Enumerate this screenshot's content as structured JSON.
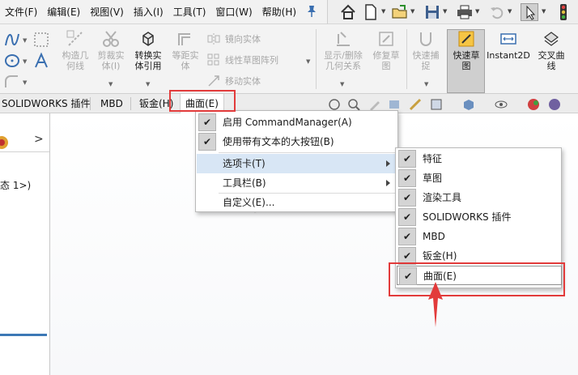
{
  "menubar": {
    "items": [
      "文件(F)",
      "编辑(E)",
      "视图(V)",
      "插入(I)",
      "工具(T)",
      "窗口(W)",
      "帮助(H)"
    ]
  },
  "quickbar": {
    "icons": [
      "home-icon",
      "new-document-icon",
      "open-folder-icon",
      "save-icon",
      "print-icon",
      "undo-icon",
      "select-pointer-icon",
      "traffic-light-icon"
    ]
  },
  "ribbon": {
    "buttons": {
      "construct_geometry": "构造几\n何线",
      "cut_entities": "剪裁实\n体(I)",
      "convert_entities": "转换实\n体引用",
      "offset_entities": "等距实\n体",
      "mirror_entities": "镜向实体",
      "linear_pattern": "线性草图阵列",
      "move_entities": "移动实体",
      "show_delete_relations": "显示/删除\n几何关系",
      "repair_sketch": "修复草\n图",
      "quick_snaps": "快速捕\n捉",
      "rapid_sketch": "快速草\n图",
      "instant2d": "Instant2D",
      "intersection_curve": "交叉曲\n线"
    }
  },
  "tabs": {
    "plugins": "SOLIDWORKS 插件",
    "mbd": "MBD",
    "sheet_metal": "钣金(H)",
    "surfaces": "曲面(E)"
  },
  "left_panel": {
    "tree_text": "态 1>)",
    "arrow": ">"
  },
  "context_menu": {
    "items": [
      {
        "label": "启用 CommandManager(A)",
        "checked": true
      },
      {
        "label": "使用带有文本的大按钮(B)",
        "checked": true
      },
      {
        "label": "选项卡(T)",
        "submenu": true
      },
      {
        "label": "工具栏(B)",
        "submenu": true
      },
      {
        "label": "自定义(E)..."
      }
    ]
  },
  "tabs_submenu": {
    "items": [
      {
        "label": "特征",
        "checked": true
      },
      {
        "label": "草图",
        "checked": true
      },
      {
        "label": "渲染工具",
        "checked": true
      },
      {
        "label": "SOLIDWORKS 插件",
        "checked": true
      },
      {
        "label": "MBD",
        "checked": true
      },
      {
        "label": "钣金(H)",
        "checked": true
      },
      {
        "label": "曲面(E)",
        "checked": true
      }
    ],
    "check_glyph": "✔"
  },
  "colors": {
    "annotation_red": "#e23b3b",
    "highlight_blue": "#d8e6f5",
    "checkbox_gray": "#d4d4d4"
  }
}
